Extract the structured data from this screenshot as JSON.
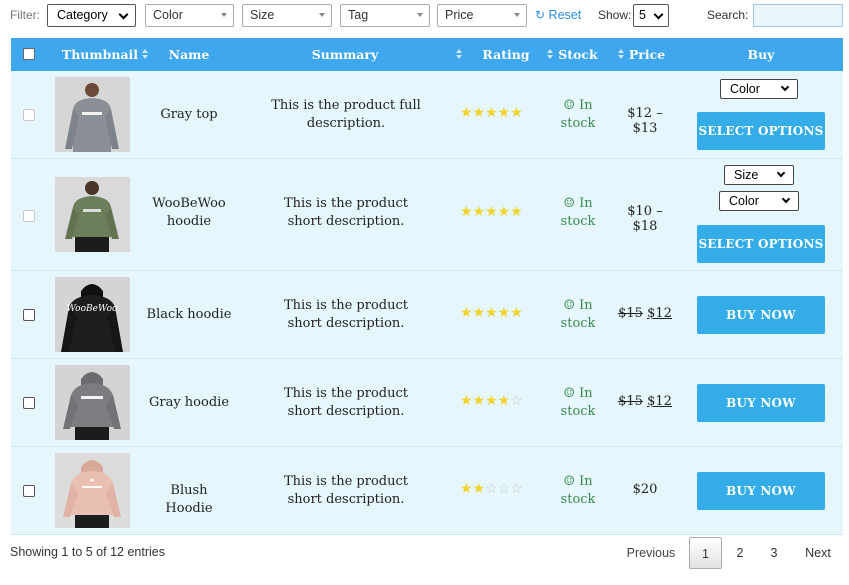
{
  "filter": {
    "label": "Filter:",
    "selects": [
      {
        "name": "category",
        "value": "Category"
      },
      {
        "name": "color",
        "value": "Color"
      },
      {
        "name": "size",
        "value": "Size"
      },
      {
        "name": "tag",
        "value": "Tag"
      },
      {
        "name": "price",
        "value": "Price"
      }
    ],
    "reset_label": "Reset",
    "show_label": "Show:",
    "show_value": "5",
    "search_label": "Search:",
    "search_value": ""
  },
  "columns": [
    "Thumbnail",
    "Name",
    "Summary",
    "Rating",
    "Stock",
    "Price",
    "Buy"
  ],
  "stock_label": "In stock",
  "rows": [
    {
      "name": "Gray top",
      "summary": "This is the product full description.",
      "rating": 5,
      "price": "$12 – $13",
      "price_old": "",
      "price_new": "",
      "variant_selects": [
        "Color"
      ],
      "button": "SELECT OPTIONS",
      "thumb_bg": "#d6d6d6",
      "garment": "#8a8f96",
      "logo": "WOOBEWOO"
    },
    {
      "name": "WooBeWoo hoodie",
      "summary": "This is the product short description.",
      "rating": 5,
      "price": "$10 – $18",
      "price_old": "",
      "price_new": "",
      "variant_selects": [
        "Size",
        "Color"
      ],
      "button": "SELECT OPTIONS",
      "thumb_bg": "#d9d9d9",
      "garment": "#6d7e5a",
      "logo": "WooBeWoo"
    },
    {
      "name": "Black hoodie",
      "summary": "This is the product short description.",
      "rating": 5,
      "price": "",
      "price_old": "$15",
      "price_new": "$12",
      "variant_selects": [],
      "button": "BUY NOW",
      "thumb_bg": "#d4d4d4",
      "garment": "#1e1e1e",
      "logo": "WooBeWoo"
    },
    {
      "name": "Gray hoodie",
      "summary": "This is the product short description.",
      "rating": 4,
      "price": "",
      "price_old": "$15",
      "price_new": "$12",
      "variant_selects": [],
      "button": "BUY NOW",
      "thumb_bg": "#d4d4d4",
      "garment": "#7c7d80",
      "logo": "WOOBEWOO"
    },
    {
      "name": "Blush Hoodie",
      "summary": "This is the product short description.",
      "rating": 2,
      "price": "$20",
      "price_old": "",
      "price_new": "",
      "variant_selects": [],
      "button": "BUY NOW",
      "thumb_bg": "#dcdcdc",
      "garment": "#e9bfb2",
      "logo": "WooBeWoo"
    }
  ],
  "footer": {
    "info": "Showing 1 to 5 of 12 entries",
    "previous": "Previous",
    "pages": [
      "1",
      "2",
      "3"
    ],
    "current_page": "1",
    "next": "Next"
  },
  "colors": {
    "header_bg": "#3fa7ed",
    "row_bg": "#e6f6fd",
    "button_bg": "#33ace8",
    "star": "#f0d42b",
    "stock": "#3a8b4a"
  }
}
